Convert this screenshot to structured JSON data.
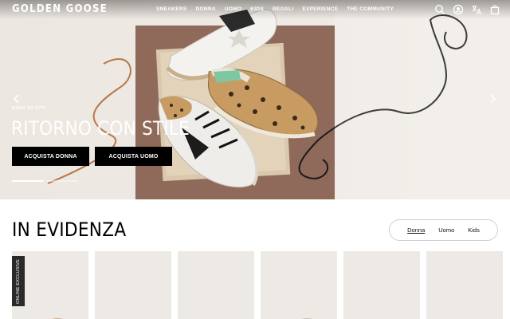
{
  "header": {
    "logo": "GOLDEN GOOSE",
    "nav": [
      "SNEAKERS",
      "DONNA",
      "UOMO",
      "KIDS",
      "REGALI",
      "EXPERIENCE",
      "THE COMMUNITY"
    ],
    "icons": [
      "search-icon",
      "account-icon",
      "translate-icon",
      "bag-icon"
    ]
  },
  "hero": {
    "eyebrow": "BACK TO CITY",
    "title": "RITORNO CON STILE",
    "cta_donna": "ACQUISTA DONNA",
    "cta_uomo": "ACQUISTA UOMO",
    "slides": 2,
    "active_slide": 1
  },
  "section": {
    "title": "IN EVIDENZA",
    "tabs": [
      "Donna",
      "Uomo",
      "Kids"
    ],
    "active_tab": "Donna",
    "badge": "ONLINE EXCLUSIVE",
    "cards": 6
  },
  "colors": {
    "hero_bg": "#ece7e1",
    "card_bg": "#ede9e4",
    "cta_bg": "#000000",
    "badge_bg": "#2a2a2a"
  }
}
